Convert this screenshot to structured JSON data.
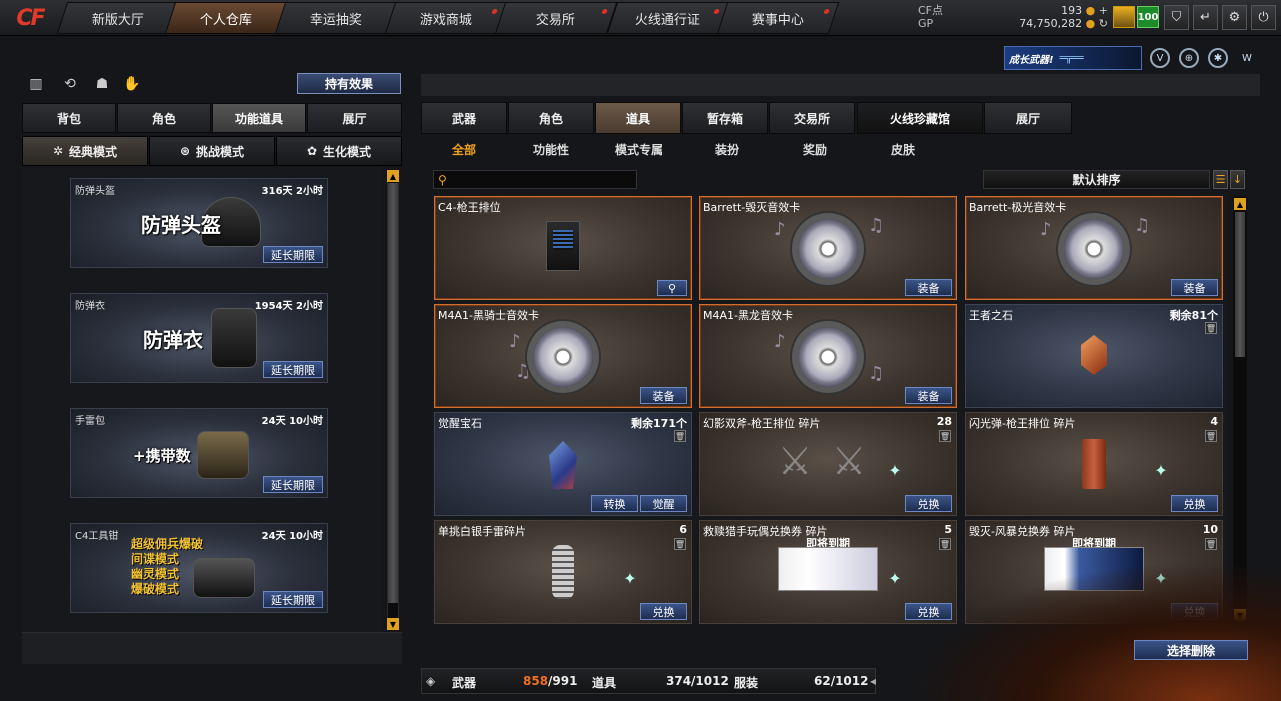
{
  "nav": {
    "logo": "CF",
    "tabs": [
      {
        "label": "新版大厅"
      },
      {
        "label": "个人仓库"
      },
      {
        "label": "幸运抽奖"
      },
      {
        "label": "游戏商城"
      },
      {
        "label": "交易所"
      },
      {
        "label": "火线通行证"
      },
      {
        "label": "赛事中心"
      }
    ],
    "active_tab": "个人仓库"
  },
  "currency": {
    "cf_label": "CF点",
    "cf_value": "193",
    "gp_label": "GP",
    "gp_value": "74,750,282"
  },
  "player": {
    "level": "100"
  },
  "banner": {
    "growth_label": "成长武器!"
  },
  "left": {
    "hold_effect_label": "持有效果",
    "tabs": [
      "背包",
      "角色",
      "功能道具",
      "展厅"
    ],
    "active_tab": "功能道具",
    "mode_tabs": [
      "经典模式",
      "挑战模式",
      "生化模式"
    ],
    "active_mode": "经典模式",
    "items": [
      {
        "name": "防弹头盔",
        "time": "316天 2小时",
        "big": "防弹头盔",
        "action": "延长期限"
      },
      {
        "name": "防弹衣",
        "time": "1954天 2小时",
        "big": "防弹衣",
        "action": "延长期限"
      },
      {
        "name": "手雷包",
        "time": "24天 10小时",
        "big": "+携带数",
        "action": "延长期限"
      },
      {
        "name": "C4工具钳",
        "time": "24天 10小时",
        "big_lines": [
          "超级佣兵爆破",
          "间谍模式",
          "幽灵模式",
          "爆破模式"
        ],
        "action": "延长期限"
      }
    ]
  },
  "right": {
    "tabs": [
      "武器",
      "角色",
      "道具",
      "暂存箱",
      "交易所",
      "火线珍藏馆",
      "展厅"
    ],
    "active_tab": "道具",
    "subtabs": [
      "全部",
      "功能性",
      "模式专属",
      "装扮",
      "奖励",
      "皮肤"
    ],
    "active_subtab": "全部",
    "search_placeholder": "",
    "sort_label": "默认排序",
    "cards": [
      {
        "title": "C4-枪王排位",
        "count": "",
        "kind": "c4",
        "buttons": [],
        "magnify": true
      },
      {
        "title": "Barrett-毁灭音效卡",
        "count": "",
        "kind": "disc",
        "buttons": [
          "装备"
        ]
      },
      {
        "title": "Barrett-极光音效卡",
        "count": "",
        "kind": "disc",
        "buttons": [
          "装备"
        ]
      },
      {
        "title": "M4A1-黑骑士音效卡",
        "count": "",
        "kind": "disc",
        "buttons": [
          "装备"
        ]
      },
      {
        "title": "M4A1-黑龙音效卡",
        "count": "",
        "kind": "disc",
        "buttons": [
          "装备"
        ]
      },
      {
        "title": "王者之石",
        "count": "剩余81个",
        "kind": "redgem",
        "buttons": [],
        "trash": true
      },
      {
        "title": "觉醒宝石",
        "count": "剩余171个",
        "kind": "gem",
        "buttons": [
          "转换",
          "觉醒"
        ],
        "trash": true
      },
      {
        "title": "幻影双斧-枪王排位 碎片",
        "count": "28",
        "kind": "axe",
        "buttons": [
          "兑换"
        ],
        "trash": true
      },
      {
        "title": "闪光弹-枪王排位 碎片",
        "count": "4",
        "kind": "canister",
        "buttons": [
          "兑换"
        ],
        "trash": true
      },
      {
        "title": "单挑白银手雷碎片",
        "count": "6",
        "kind": "grenade",
        "buttons": [
          "兑换"
        ],
        "trash": true
      },
      {
        "title": "救赎猎手玩偶兑换券 碎片",
        "count": "5",
        "kind": "ticket",
        "expire": "即将到期",
        "buttons": [
          "兑换"
        ],
        "trash": true
      },
      {
        "title": "毁灭-风暴兑换券 碎片",
        "count": "10",
        "kind": "ticket-blue",
        "expire": "即将到期",
        "buttons": [
          "兑换"
        ],
        "trash": true
      }
    ],
    "delete_label": "选择删除"
  },
  "capacity": {
    "weapon_label": "武器",
    "weapon_used": "858",
    "weapon_total": "/991",
    "item_label": "道具",
    "item_value": "374/1012",
    "outfit_label": "服装",
    "outfit_value": "62/1012"
  }
}
